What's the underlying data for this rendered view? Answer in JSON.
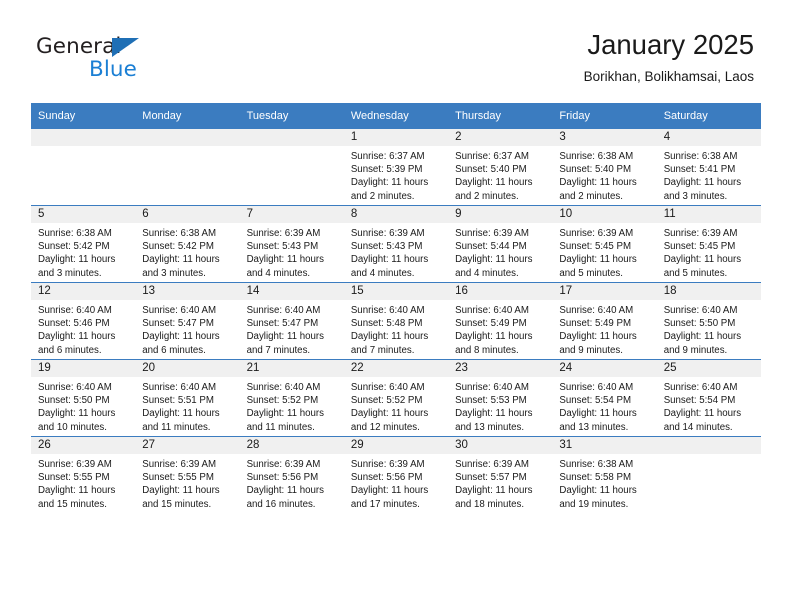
{
  "logo": {
    "word_top": "General",
    "word_bottom": "Blue",
    "triangle_icon": "triangle-icon",
    "color_dark": "#231f20",
    "color_blue": "#1b7fd4"
  },
  "header": {
    "title": "January 2025",
    "subtitle": "Borikhan, Bolikhamsai, Laos"
  },
  "colors": {
    "header_band": "#3b7cc0",
    "daynum_band": "#f0f0f0",
    "text": "#1a1a1a"
  },
  "weekdays": [
    "Sunday",
    "Monday",
    "Tuesday",
    "Wednesday",
    "Thursday",
    "Friday",
    "Saturday"
  ],
  "weeks": [
    [
      {
        "day": "",
        "sunrise": "",
        "sunset": "",
        "daylight": ""
      },
      {
        "day": "",
        "sunrise": "",
        "sunset": "",
        "daylight": ""
      },
      {
        "day": "",
        "sunrise": "",
        "sunset": "",
        "daylight": ""
      },
      {
        "day": "1",
        "sunrise": "Sunrise: 6:37 AM",
        "sunset": "Sunset: 5:39 PM",
        "daylight": "Daylight: 11 hours and 2 minutes."
      },
      {
        "day": "2",
        "sunrise": "Sunrise: 6:37 AM",
        "sunset": "Sunset: 5:40 PM",
        "daylight": "Daylight: 11 hours and 2 minutes."
      },
      {
        "day": "3",
        "sunrise": "Sunrise: 6:38 AM",
        "sunset": "Sunset: 5:40 PM",
        "daylight": "Daylight: 11 hours and 2 minutes."
      },
      {
        "day": "4",
        "sunrise": "Sunrise: 6:38 AM",
        "sunset": "Sunset: 5:41 PM",
        "daylight": "Daylight: 11 hours and 3 minutes."
      }
    ],
    [
      {
        "day": "5",
        "sunrise": "Sunrise: 6:38 AM",
        "sunset": "Sunset: 5:42 PM",
        "daylight": "Daylight: 11 hours and 3 minutes."
      },
      {
        "day": "6",
        "sunrise": "Sunrise: 6:38 AM",
        "sunset": "Sunset: 5:42 PM",
        "daylight": "Daylight: 11 hours and 3 minutes."
      },
      {
        "day": "7",
        "sunrise": "Sunrise: 6:39 AM",
        "sunset": "Sunset: 5:43 PM",
        "daylight": "Daylight: 11 hours and 4 minutes."
      },
      {
        "day": "8",
        "sunrise": "Sunrise: 6:39 AM",
        "sunset": "Sunset: 5:43 PM",
        "daylight": "Daylight: 11 hours and 4 minutes."
      },
      {
        "day": "9",
        "sunrise": "Sunrise: 6:39 AM",
        "sunset": "Sunset: 5:44 PM",
        "daylight": "Daylight: 11 hours and 4 minutes."
      },
      {
        "day": "10",
        "sunrise": "Sunrise: 6:39 AM",
        "sunset": "Sunset: 5:45 PM",
        "daylight": "Daylight: 11 hours and 5 minutes."
      },
      {
        "day": "11",
        "sunrise": "Sunrise: 6:39 AM",
        "sunset": "Sunset: 5:45 PM",
        "daylight": "Daylight: 11 hours and 5 minutes."
      }
    ],
    [
      {
        "day": "12",
        "sunrise": "Sunrise: 6:40 AM",
        "sunset": "Sunset: 5:46 PM",
        "daylight": "Daylight: 11 hours and 6 minutes."
      },
      {
        "day": "13",
        "sunrise": "Sunrise: 6:40 AM",
        "sunset": "Sunset: 5:47 PM",
        "daylight": "Daylight: 11 hours and 6 minutes."
      },
      {
        "day": "14",
        "sunrise": "Sunrise: 6:40 AM",
        "sunset": "Sunset: 5:47 PM",
        "daylight": "Daylight: 11 hours and 7 minutes."
      },
      {
        "day": "15",
        "sunrise": "Sunrise: 6:40 AM",
        "sunset": "Sunset: 5:48 PM",
        "daylight": "Daylight: 11 hours and 7 minutes."
      },
      {
        "day": "16",
        "sunrise": "Sunrise: 6:40 AM",
        "sunset": "Sunset: 5:49 PM",
        "daylight": "Daylight: 11 hours and 8 minutes."
      },
      {
        "day": "17",
        "sunrise": "Sunrise: 6:40 AM",
        "sunset": "Sunset: 5:49 PM",
        "daylight": "Daylight: 11 hours and 9 minutes."
      },
      {
        "day": "18",
        "sunrise": "Sunrise: 6:40 AM",
        "sunset": "Sunset: 5:50 PM",
        "daylight": "Daylight: 11 hours and 9 minutes."
      }
    ],
    [
      {
        "day": "19",
        "sunrise": "Sunrise: 6:40 AM",
        "sunset": "Sunset: 5:50 PM",
        "daylight": "Daylight: 11 hours and 10 minutes."
      },
      {
        "day": "20",
        "sunrise": "Sunrise: 6:40 AM",
        "sunset": "Sunset: 5:51 PM",
        "daylight": "Daylight: 11 hours and 11 minutes."
      },
      {
        "day": "21",
        "sunrise": "Sunrise: 6:40 AM",
        "sunset": "Sunset: 5:52 PM",
        "daylight": "Daylight: 11 hours and 11 minutes."
      },
      {
        "day": "22",
        "sunrise": "Sunrise: 6:40 AM",
        "sunset": "Sunset: 5:52 PM",
        "daylight": "Daylight: 11 hours and 12 minutes."
      },
      {
        "day": "23",
        "sunrise": "Sunrise: 6:40 AM",
        "sunset": "Sunset: 5:53 PM",
        "daylight": "Daylight: 11 hours and 13 minutes."
      },
      {
        "day": "24",
        "sunrise": "Sunrise: 6:40 AM",
        "sunset": "Sunset: 5:54 PM",
        "daylight": "Daylight: 11 hours and 13 minutes."
      },
      {
        "day": "25",
        "sunrise": "Sunrise: 6:40 AM",
        "sunset": "Sunset: 5:54 PM",
        "daylight": "Daylight: 11 hours and 14 minutes."
      }
    ],
    [
      {
        "day": "26",
        "sunrise": "Sunrise: 6:39 AM",
        "sunset": "Sunset: 5:55 PM",
        "daylight": "Daylight: 11 hours and 15 minutes."
      },
      {
        "day": "27",
        "sunrise": "Sunrise: 6:39 AM",
        "sunset": "Sunset: 5:55 PM",
        "daylight": "Daylight: 11 hours and 15 minutes."
      },
      {
        "day": "28",
        "sunrise": "Sunrise: 6:39 AM",
        "sunset": "Sunset: 5:56 PM",
        "daylight": "Daylight: 11 hours and 16 minutes."
      },
      {
        "day": "29",
        "sunrise": "Sunrise: 6:39 AM",
        "sunset": "Sunset: 5:56 PM",
        "daylight": "Daylight: 11 hours and 17 minutes."
      },
      {
        "day": "30",
        "sunrise": "Sunrise: 6:39 AM",
        "sunset": "Sunset: 5:57 PM",
        "daylight": "Daylight: 11 hours and 18 minutes."
      },
      {
        "day": "31",
        "sunrise": "Sunrise: 6:38 AM",
        "sunset": "Sunset: 5:58 PM",
        "daylight": "Daylight: 11 hours and 19 minutes."
      },
      {
        "day": "",
        "sunrise": "",
        "sunset": "",
        "daylight": ""
      }
    ]
  ]
}
